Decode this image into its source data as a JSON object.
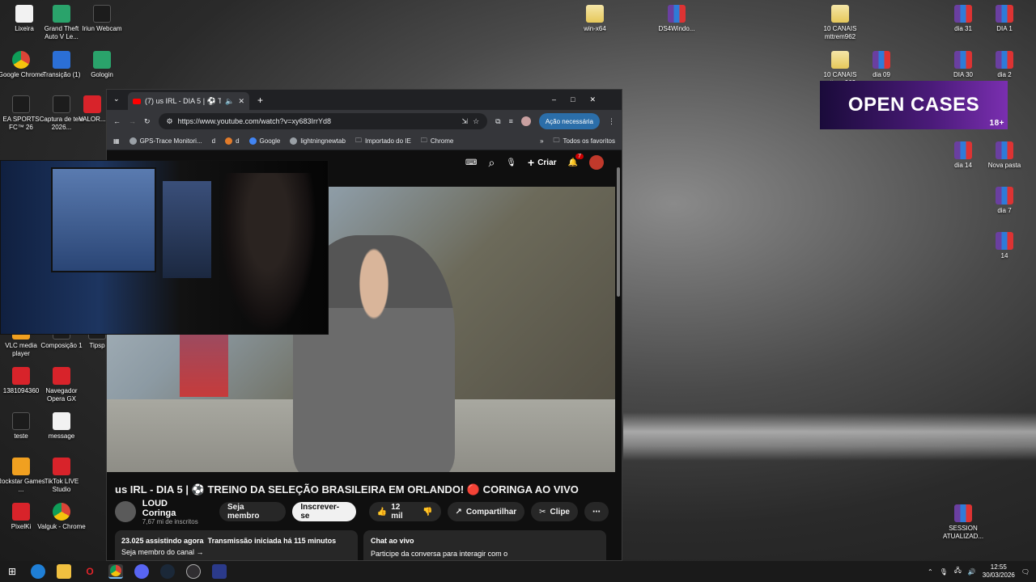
{
  "desktop": {
    "left_icons": [
      {
        "label": "Lixeira",
        "icon": "recycle-bin-icon"
      },
      {
        "label": "Grand Theft Auto V Le...",
        "icon": "gta-icon"
      },
      {
        "label": "Iriun Webcam",
        "icon": "webcam-icon"
      },
      {
        "label": "Google Chrome",
        "icon": "chrome-icon"
      },
      {
        "label": "Transição (1)",
        "icon": "file-icon"
      },
      {
        "label": "Gologin",
        "icon": "gologin-icon"
      },
      {
        "label": "EA SPORTS FC™ 26",
        "icon": "easports-icon"
      },
      {
        "label": "Captura de tela 2026...",
        "icon": "image-icon"
      },
      {
        "label": "VALOR...",
        "icon": "valorant-icon"
      },
      {
        "label": "VLC media player",
        "icon": "vlc-icon"
      },
      {
        "label": "Composição 1",
        "icon": "file-icon"
      },
      {
        "label": "Tipsp",
        "icon": "file-icon"
      },
      {
        "label": "1381094360",
        "icon": "app-icon"
      },
      {
        "label": "Navegador Opera GX",
        "icon": "opera-icon"
      },
      {
        "label": "teste",
        "icon": "file-icon"
      },
      {
        "label": "message",
        "icon": "text-file-icon"
      },
      {
        "label": "Rockstar Games ...",
        "icon": "rockstar-icon"
      },
      {
        "label": "TikTok LIVE Studio",
        "icon": "tiktok-icon"
      },
      {
        "label": "PixelKi",
        "icon": "app-icon"
      },
      {
        "label": "Valguk - Chrome",
        "icon": "chrome-icon"
      }
    ],
    "right_icons": [
      {
        "label": "win-x64",
        "icon": "folder-icon"
      },
      {
        "label": "DS4Windo...",
        "icon": "rar-icon"
      },
      {
        "label": "10 CANAIS mttrem962",
        "icon": "folder-icon"
      },
      {
        "label": "dia 31",
        "icon": "rar-icon"
      },
      {
        "label": "DIA 1",
        "icon": "rar-icon"
      },
      {
        "label": "10 CANAIS mttrem962",
        "icon": "folder-icon"
      },
      {
        "label": "dia 09",
        "icon": "rar-icon"
      },
      {
        "label": "DIA 30",
        "icon": "rar-icon"
      },
      {
        "label": "dia 2",
        "icon": "rar-icon"
      },
      {
        "label": "dia 14",
        "icon": "rar-icon"
      },
      {
        "label": "Nova pasta",
        "icon": "rar-icon"
      },
      {
        "label": "dia 7",
        "icon": "rar-icon"
      },
      {
        "label": "14",
        "icon": "rar-icon"
      },
      {
        "label": "SESSION ATUALIZAD...",
        "icon": "rar-icon"
      }
    ],
    "banner": {
      "text": "OPEN CASES",
      "badge": "18+"
    }
  },
  "browser": {
    "tab_title": "(7) us IRL - DIA 5 | ⚽ TRE",
    "url": "https://www.youtube.com/watch?v=xy683IrrYd8",
    "acao_label": "Ação necessária",
    "bookmarks": [
      "GPS-Trace Monitori...",
      "d",
      "d",
      "Google",
      "lightningnewtab",
      "Importado do IE",
      "Chrome"
    ],
    "all_bookmarks": "Todos os favoritos"
  },
  "youtube": {
    "create_label": "Criar",
    "notif_count": "7",
    "video_title": "us IRL - DIA 5 | ⚽ TREINO DA SELEÇÃO BRASILEIRA EM ORLANDO! 🔴 CORINGA AO VIVO",
    "channel_name": "LOUD Coringa",
    "subscribers": "7,67 mi de inscritos",
    "member_label": "Seja membro",
    "subscribe_label": "Inscrever-se",
    "likes": "12 mil",
    "share_label": "Compartilhar",
    "clip_label": "Clipe",
    "watching": "23.025 assistindo agora",
    "started": "Transmissão iniciada há 115 minutos",
    "member_link": "Seja membro do canal →",
    "chat_title": "Chat ao vivo",
    "chat_prompt": "Participe da conversa para interagir com o"
  },
  "taskbar": {
    "time": "12:55",
    "date": "30/03/2026"
  }
}
